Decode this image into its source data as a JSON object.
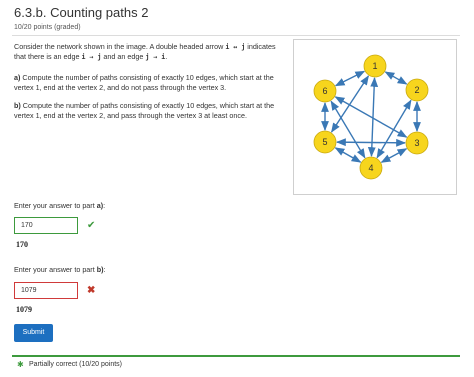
{
  "header": {
    "title": "6.3.b. Counting paths 2",
    "subtitle": "10/20 points (graded)"
  },
  "question": {
    "intro_1": "Consider the network shown in the image. A double headed arrow",
    "intro_expr": "i ↔ j",
    "intro_2": "indicates that there is an edge",
    "edge_1": "i → j",
    "intro_3": "and an edge",
    "edge_2": "j → i",
    "intro_4": ".",
    "part_a_label": "a)",
    "part_a_text": "Compute the number of paths consisting of exactly 10 edges, which start at the vertex 1, end at the vertex 2, and do not pass through the vertex 3.",
    "part_b_label": "b)",
    "part_b_text": "Compute the number of paths consisting of exactly 10 edges, which start at the vertex 1, end at the vertex 2, and pass through the vertex 3 at least once."
  },
  "graph": {
    "node_color": "#f7d51d",
    "edge_color": "#3a78b5",
    "nodes": [
      "1",
      "2",
      "3",
      "4",
      "5",
      "6"
    ]
  },
  "part_a": {
    "prompt": "Enter your answer to part",
    "prompt_part": "a)",
    "prompt_end": ":",
    "value": "170",
    "echo": "170",
    "status_icon": "check-icon"
  },
  "part_b": {
    "prompt": "Enter your answer to part",
    "prompt_part": "b)",
    "prompt_end": ":",
    "value": "1079",
    "echo": "1079",
    "status_icon": "cross-icon"
  },
  "actions": {
    "submit_label": "Submit"
  },
  "status": {
    "text": "Partially correct (10/20 points)",
    "color": "#3d9a3d"
  }
}
